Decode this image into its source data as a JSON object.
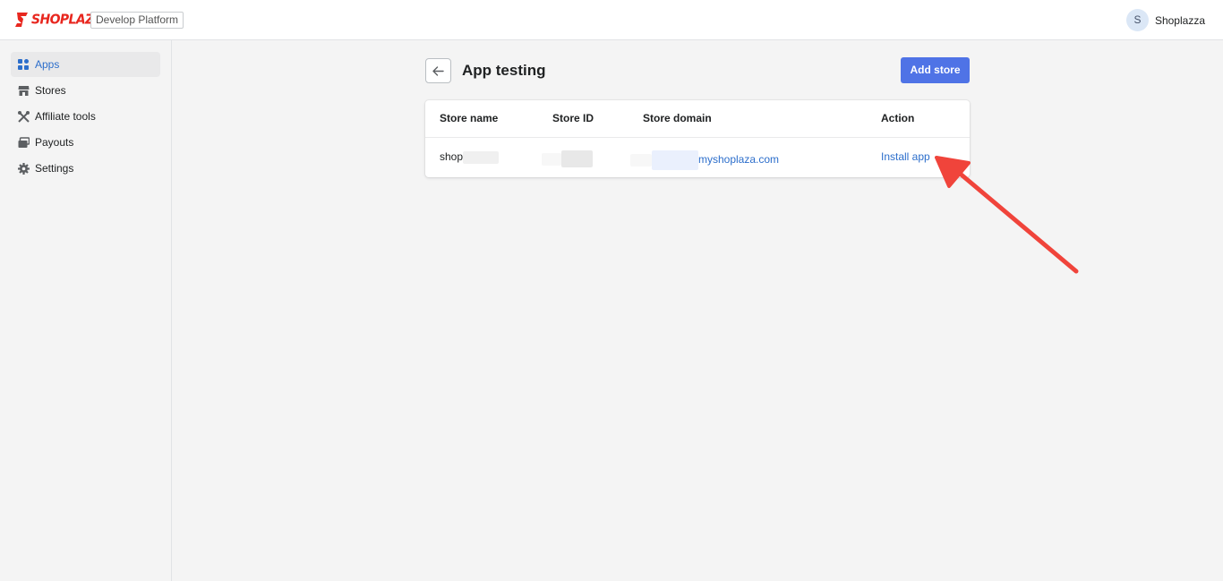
{
  "header": {
    "brand": "SHOPLAZZA",
    "platform_label": "Develop Platform",
    "avatar_initial": "S",
    "user_name": "Shoplazza"
  },
  "sidebar": {
    "items": [
      {
        "label": "Apps",
        "icon": "apps-icon",
        "active": true
      },
      {
        "label": "Stores",
        "icon": "store-icon",
        "active": false
      },
      {
        "label": "Affiliate tools",
        "icon": "tools-icon",
        "active": false
      },
      {
        "label": "Payouts",
        "icon": "payouts-icon",
        "active": false
      },
      {
        "label": "Settings",
        "icon": "gear-icon",
        "active": false
      }
    ]
  },
  "page": {
    "title": "App testing",
    "add_store_label": "Add store"
  },
  "table": {
    "columns": [
      "Store name",
      "Store ID",
      "Store domain",
      "Action"
    ],
    "rows": [
      {
        "store_name": "shop",
        "store_id": "",
        "store_domain": "myshoplaza.com",
        "action": "Install app"
      }
    ]
  },
  "colors": {
    "brand": "#e8271f",
    "primary": "#4f73e6",
    "link": "#2c6ecb",
    "annotation_arrow": "#f0443b"
  }
}
